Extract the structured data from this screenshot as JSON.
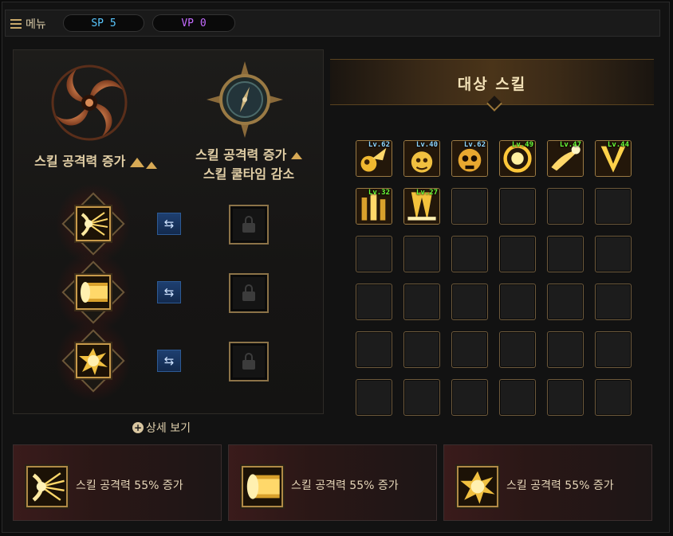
{
  "topbar": {
    "menu_label": "메뉴",
    "sp_label": "SP 5",
    "vp_label": "VP 0"
  },
  "left_panel": {
    "emblem_left_label": "스킬 공격력 증가",
    "emblem_right_label_line1": "스킬 공격력 증가",
    "emblem_right_label_line2": "스킬 쿨타임 감소",
    "active_skills": [
      {
        "icon": "radiant-burst-skill-icon"
      },
      {
        "icon": "light-beam-skill-icon"
      },
      {
        "icon": "explosion-skill-icon"
      }
    ],
    "locked_slots": 3,
    "detail_link": "상세 보기"
  },
  "target_skills": {
    "title": "대상 스킬",
    "skills": [
      {
        "level": "Lv.62",
        "color": "#8fd6ff",
        "icon": "golden-creature-skill-icon"
      },
      {
        "level": "Lv.40",
        "color": "#8fd6ff",
        "icon": "golden-bomb-skill-icon"
      },
      {
        "level": "Lv.62",
        "color": "#8fd6ff",
        "icon": "golden-skull-skill-icon"
      },
      {
        "level": "Lv.49",
        "color": "#6dff3a",
        "icon": "golden-vortex-skill-icon"
      },
      {
        "level": "Lv.47",
        "color": "#6dff3a",
        "icon": "golden-comet-skill-icon"
      },
      {
        "level": "Lv.44",
        "color": "#6dff3a",
        "icon": "golden-v-slash-skill-icon"
      },
      {
        "level": "Lv.32",
        "color": "#6dff3a",
        "icon": "golden-pillars-skill-icon"
      },
      {
        "level": "Lv.27",
        "color": "#6dff3a",
        "icon": "golden-lightfall-skill-icon"
      }
    ],
    "grid_rows": 6,
    "grid_cols": 6
  },
  "bottom_cards": [
    {
      "text": "스킬 공격력 55% 증가",
      "icon": "radiant-burst-skill-icon"
    },
    {
      "text": "스킬 공격력 55% 증가",
      "icon": "light-beam-skill-icon"
    },
    {
      "text": "스킬 공격력 55% 증가",
      "icon": "explosion-skill-icon"
    }
  ],
  "colors": {
    "accent_gold": "#c79a4a",
    "sp_blue": "#59c7ff",
    "vp_purple": "#c46bff",
    "level_green": "#6dff3a",
    "level_blue": "#8fd6ff"
  }
}
